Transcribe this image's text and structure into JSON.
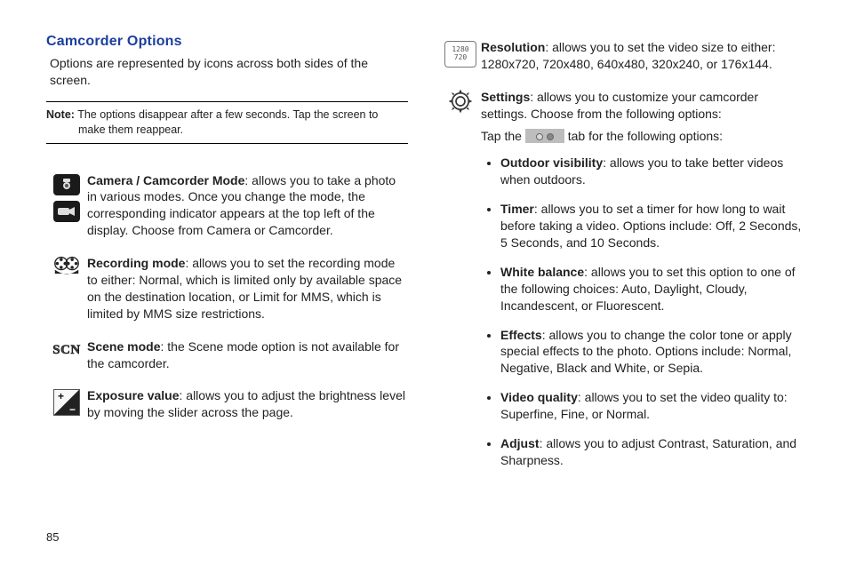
{
  "pageNumber": "85",
  "heading": "Camcorder Options",
  "intro": "Options are represented by icons across both sides of the screen.",
  "note": {
    "label": "Note:",
    "text": "The options disappear after a few seconds. Tap the screen to make them reappear."
  },
  "left_options": [
    {
      "id": "camera-mode",
      "icon": "camera+camcorder",
      "title": "Camera / Camcorder Mode",
      "body": ": allows you to take a photo in various modes. Once you change the mode, the corresponding indicator appears at the top left of the display. Choose from Camera or Camcorder."
    },
    {
      "id": "recording-mode",
      "icon": "reel",
      "title": "Recording mode",
      "body": ": allows you to set the recording mode to either: Normal, which is limited only by available space on the destination location, or Limit for MMS, which is limited by MMS size restrictions."
    },
    {
      "id": "scene-mode",
      "icon": "scn",
      "title": "Scene mode",
      "body": ": the Scene mode option is not available for the camcorder."
    },
    {
      "id": "exposure-value",
      "icon": "ev",
      "title": "Exposure value",
      "body": ": allows you to adjust the brightness level by moving the slider across the page."
    }
  ],
  "right_options": {
    "resolution": {
      "icon": "resolution",
      "title": "Resolution",
      "body": ": allows you to set the video size to either: 1280x720, 720x480, 640x480, 320x240, or 176x144.",
      "iconText1": "1280",
      "iconText2": "720"
    },
    "settings": {
      "icon": "gear",
      "title": "Settings",
      "lead": ": allows you to customize your camcorder settings. Choose from the following options:",
      "tapPrefix": "Tap the",
      "tapSuffix": "tab for the following options:",
      "bullets": [
        {
          "title": "Outdoor visibility",
          "body": ": allows you to take better videos when outdoors."
        },
        {
          "title": "Timer",
          "body": ": allows you to set a timer for how long to wait before taking a video. Options include: Off, 2 Seconds, 5 Seconds, and 10 Seconds."
        },
        {
          "title": "White balance",
          "body": ": allows you to set this option to one of the following choices: Auto, Daylight, Cloudy, Incandescent, or Fluorescent."
        },
        {
          "title": "Effects",
          "body": ": allows you to change the color tone or apply special effects to the photo. Options include: Normal, Negative, Black and White, or Sepia."
        },
        {
          "title": "Video quality",
          "body": ": allows you to set the video quality to: Superfine, Fine, or Normal."
        },
        {
          "title": "Adjust",
          "body": ": allows you to adjust Contrast, Saturation, and Sharpness."
        }
      ]
    }
  }
}
